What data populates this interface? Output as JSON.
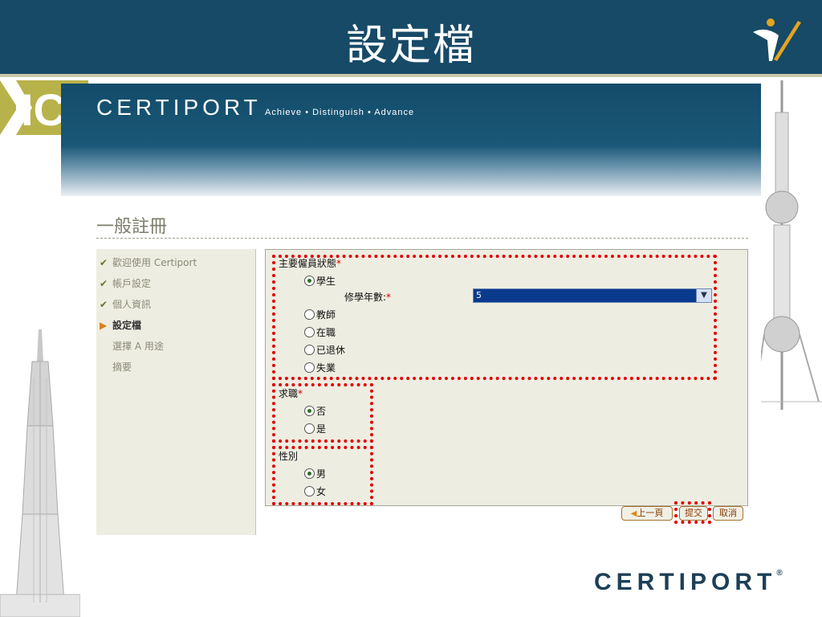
{
  "slide": {
    "title": "設定檔",
    "footer_logo": "CERTIPORT",
    "footer_registered": "®",
    "badge_text": "IC"
  },
  "header": {
    "logo": "CERTIPORT",
    "tagline": "Achieve • Distinguish • Advance"
  },
  "page": {
    "heading": "一般註冊"
  },
  "sidebar": {
    "items": [
      {
        "label": "歡迎使用 Certiport",
        "state": "done",
        "mark": "✔"
      },
      {
        "label": "帳戶設定",
        "state": "done",
        "mark": "✔"
      },
      {
        "label": "個人資訊",
        "state": "done",
        "mark": "✔"
      },
      {
        "label": "設定檔",
        "state": "current",
        "mark": "▶"
      },
      {
        "label": "選擇 A 用途",
        "state": "pending",
        "mark": ""
      },
      {
        "label": "摘要",
        "state": "pending",
        "mark": ""
      }
    ]
  },
  "form": {
    "status": {
      "label": "主要僱員狀態",
      "required": "*",
      "options": [
        "學生",
        "教師",
        "在職",
        "已退休",
        "失業"
      ],
      "selected": "學生"
    },
    "years": {
      "label": "修學年數:",
      "required": "*",
      "value": "5",
      "dropdown_icon": "chevron-down-icon"
    },
    "job_seeking": {
      "label": "求職",
      "required": "*",
      "options": [
        "否",
        "是"
      ],
      "selected": "否"
    },
    "gender": {
      "label": "性別",
      "options": [
        "男",
        "女"
      ],
      "selected": "男"
    }
  },
  "buttons": {
    "prev": "上一頁",
    "submit": "提交",
    "cancel": "取消"
  },
  "colors": {
    "title_bar": "#174a67",
    "highlight": "#e00000",
    "panel": "#eeede1"
  }
}
